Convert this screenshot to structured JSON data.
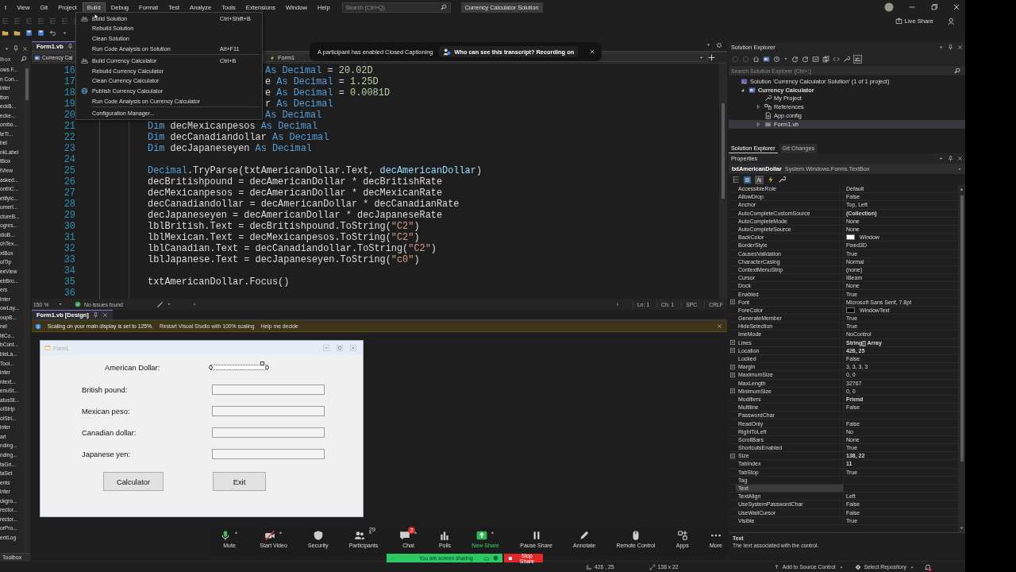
{
  "menu_bar": {
    "items": [
      {
        "label": "t",
        "selected": false
      },
      {
        "label": "View",
        "selected": false
      },
      {
        "label": "Git",
        "selected": false
      },
      {
        "label": "Project",
        "selected": false
      },
      {
        "label": "Build",
        "selected": true
      },
      {
        "label": "Debug",
        "selected": false
      },
      {
        "label": "Format",
        "selected": false
      },
      {
        "label": "Test",
        "selected": false
      },
      {
        "label": "Analyze",
        "selected": false
      },
      {
        "label": "Tools",
        "selected": false
      },
      {
        "label": "Extensions",
        "selected": false
      },
      {
        "label": "Window",
        "selected": false
      },
      {
        "label": "Help",
        "selected": false
      }
    ],
    "search": {
      "placeholder": "Search (Ctrl+Q)"
    },
    "solution_name": "Currency Calculator Solution"
  },
  "toolbar": {
    "live_share": "Live Share"
  },
  "build_menu": {
    "items": [
      {
        "kind": "build",
        "label": "Build Solution",
        "shortcut": "Ctrl+Shift+B"
      },
      {
        "kind": "plain",
        "label": "Rebuild Solution"
      },
      {
        "kind": "plain",
        "label": "Clean Solution"
      },
      {
        "kind": "plain",
        "label": "Run Code Analysis on Solution",
        "shortcut": "Alt+F11"
      },
      {
        "kind": "separator"
      },
      {
        "kind": "build",
        "label": "Build Currency Calculator",
        "shortcut": "Ctrl+B"
      },
      {
        "kind": "plain",
        "label": "Rebuild Currency Calculator"
      },
      {
        "kind": "plain",
        "label": "Clean Currency Calculator"
      },
      {
        "kind": "publish",
        "label": "Publish Currency Calculator"
      },
      {
        "kind": "plain",
        "label": "Run Code Analysis on Currency Calculator"
      },
      {
        "kind": "separator"
      },
      {
        "kind": "plain",
        "label": "Configuration Manager..."
      }
    ]
  },
  "toolbox": {
    "title": "lbox",
    "items": [
      "ows F...",
      "n Con...",
      "inter",
      "tton",
      "eckB...",
      "ecke...",
      "ombo...",
      "teTi...",
      "bel",
      "nkLabel",
      "tBox",
      "tView",
      "asked...",
      "onthC...",
      "etifyIc...",
      "umerI...",
      "ctureB...",
      "ogres...",
      "dioB...",
      "chTex...",
      "xtBox",
      "olTip",
      "eeView",
      "ebBro...",
      "ers",
      "inter",
      "owLay...",
      "oupB...",
      "nel",
      "litCo...",
      "bCont...",
      "bleLa...",
      "Tool...",
      "inter",
      "ntext...",
      "enuSt...",
      "atusSt...",
      "olStrip",
      "olStri...",
      "inter",
      "art",
      "nding...",
      "nding...",
      "taGri...",
      "taSet",
      "ents",
      "inter",
      "ckgro...",
      "rector...",
      "rector...",
      "orPro...",
      "entLog"
    ],
    "tab": "Toolbox"
  },
  "editor": {
    "tab": "Form1.vb",
    "nav": [
      "Currency Cal",
      "Form1"
    ],
    "lines_behind_menu": [
      {
        "number": "16",
        "tokens": [
          {
            "t": "As Decimal",
            "kind": "kw"
          },
          {
            "t": " = ",
            "kind": "plain"
          },
          {
            "t": "20.02D",
            "kind": "num"
          }
        ]
      },
      {
        "number": "17",
        "tokens": [
          {
            "t": "e ",
            "kind": "plain"
          },
          {
            "t": "As Decimal",
            "kind": "kw"
          },
          {
            "t": " = ",
            "kind": "plain"
          },
          {
            "t": "1.25D",
            "kind": "num"
          }
        ]
      },
      {
        "number": "18",
        "tokens": [
          {
            "t": "e ",
            "kind": "plain"
          },
          {
            "t": "As Decimal",
            "kind": "kw"
          },
          {
            "t": " = ",
            "kind": "plain"
          },
          {
            "t": "0.0081D",
            "kind": "num"
          }
        ]
      },
      {
        "number": "19",
        "tokens": [
          {
            "t": "r ",
            "kind": "plain"
          },
          {
            "t": "As Decimal",
            "kind": "kw"
          }
        ]
      },
      {
        "number": "20",
        "tokens": [
          {
            "t": "As Decimal",
            "kind": "kw"
          }
        ]
      }
    ],
    "lines": [
      {
        "number": "21",
        "tokens": [
          {
            "t": "Dim ",
            "kind": "kw"
          },
          {
            "t": "decMexicanpesos",
            "kind": "plain"
          },
          {
            "t": " As Decimal",
            "kind": "kw"
          }
        ]
      },
      {
        "number": "22",
        "tokens": [
          {
            "t": "Dim ",
            "kind": "kw"
          },
          {
            "t": "decCanadiandollar",
            "kind": "plain"
          },
          {
            "t": " As Decimal",
            "kind": "kw"
          }
        ]
      },
      {
        "number": "23",
        "tokens": [
          {
            "t": "Dim ",
            "kind": "kw"
          },
          {
            "t": "decJapaneseyen",
            "kind": "plain"
          },
          {
            "t": " As Decimal",
            "kind": "kw"
          }
        ]
      },
      {
        "number": "24"
      },
      {
        "number": "25",
        "tokens": [
          {
            "t": "Decimal",
            "kind": "kw"
          },
          {
            "t": ".TryParse(txtAmericanDollar.Text, ",
            "kind": "plain"
          },
          {
            "t": "decAmericanDollar",
            "kind": "param"
          },
          {
            "t": ")",
            "kind": "plain"
          }
        ]
      },
      {
        "number": "26",
        "tokens": [
          {
            "t": "decBritishpound = decAmericanDollar * decBritishRate",
            "kind": "plain"
          }
        ]
      },
      {
        "number": "27",
        "tokens": [
          {
            "t": "decMexicanpesos = decAmericanDollar * decMexicanRate",
            "kind": "plain"
          }
        ]
      },
      {
        "number": "28",
        "tokens": [
          {
            "t": "decCanadiandollar = decAmericanDollar * decCanadianRate",
            "kind": "plain"
          }
        ]
      },
      {
        "number": "29",
        "tokens": [
          {
            "t": "decJapaneseyen = decAmericanDollar * decJapaneseRate",
            "kind": "plain"
          }
        ]
      },
      {
        "number": "30",
        "tokens": [
          {
            "t": "lblBritish.Text = decBritishpound.ToString(",
            "kind": "plain"
          },
          {
            "t": "\"C2\"",
            "kind": "str"
          },
          {
            "t": ")",
            "kind": "plain"
          }
        ]
      },
      {
        "number": "31",
        "tokens": [
          {
            "t": "lblMexican.Text = decMexicanpesos.ToString(",
            "kind": "plain"
          },
          {
            "t": "\"C2\"",
            "kind": "str"
          },
          {
            "t": ")",
            "kind": "plain"
          }
        ]
      },
      {
        "number": "32",
        "tokens": [
          {
            "t": "lblCanadian.Text = decCanadiandollar.ToString(",
            "kind": "plain"
          },
          {
            "t": "\"C2\"",
            "kind": "str"
          },
          {
            "t": ")",
            "kind": "plain"
          }
        ]
      },
      {
        "number": "33",
        "tokens": [
          {
            "t": "lblJapanese.Text = decJapaneseyen.ToString(",
            "kind": "plain"
          },
          {
            "t": "\"c0\"",
            "kind": "str"
          },
          {
            "t": ")",
            "kind": "plain"
          }
        ]
      },
      {
        "number": "34"
      },
      {
        "number": "35",
        "tokens": [
          {
            "t": "txtAmericanDollar.Focus()",
            "kind": "plain"
          }
        ]
      },
      {
        "number": "36"
      }
    ],
    "status": {
      "zoom": "150 %",
      "issues": "No issues found",
      "line": "Ln: 1",
      "column": "Ch: 1",
      "spacing": "SPC",
      "line_ending": "CRLF"
    }
  },
  "caption_banner": {
    "message": "A participant has enabled Closed Captioning",
    "link": "Who can see this transcript? Recording on"
  },
  "designer": {
    "tab": "Form1.vb [Design]",
    "info_bar": {
      "message": "Scaling on your main display is set to 125%.",
      "actions": [
        "Restart Visual Studio with 100% scaling",
        "Help me decide"
      ]
    },
    "form": {
      "title": "Form1",
      "fields": [
        {
          "label": "American Dollar:",
          "selected": true
        },
        {
          "label": "British pound:",
          "selected": false
        },
        {
          "label": "Mexican peso:",
          "selected": false
        },
        {
          "label": "Canadian dollar:",
          "selected": false
        },
        {
          "label": "Japanese yen:",
          "selected": false
        }
      ],
      "buttons": [
        "Calculator",
        "Exit"
      ]
    }
  },
  "meeting_toolbar": {
    "items": [
      {
        "kind": "mic",
        "label": "Mute",
        "menu": true
      },
      {
        "kind": "camera",
        "label": "Start Video",
        "menu": true
      },
      {
        "kind": "shield",
        "label": "Security",
        "menu": false
      },
      {
        "kind": "people",
        "label": "Participants",
        "menu": true,
        "count": "29"
      },
      {
        "kind": "chat",
        "label": "Chat",
        "menu": true,
        "badge": "2"
      },
      {
        "kind": "polls",
        "label": "Polls",
        "menu": false
      },
      {
        "kind": "share",
        "label": "New Share",
        "menu": true
      },
      {
        "kind": "pause",
        "label": "Pause Share",
        "menu": false
      },
      {
        "kind": "pencil",
        "label": "Annotate",
        "menu": false
      },
      {
        "kind": "mouse",
        "label": "Remote Control",
        "menu": false
      },
      {
        "kind": "apps",
        "label": "Apps",
        "menu": false
      },
      {
        "kind": "more",
        "label": "More",
        "menu": false
      }
    ],
    "sharing": {
      "status": "You are screen sharing",
      "stop": "Stop Share"
    }
  },
  "solution_explorer": {
    "title": "Solution Explorer",
    "search": {
      "placeholder": "Search Solution Explorer (Ctrl+;)"
    },
    "tree": [
      {
        "kind": "solution",
        "label": "Solution 'Currency Calculator Solution' (1 of 1 project)",
        "selected": false,
        "children": [
          {
            "kind": "project",
            "label": "Currency Calculator",
            "expanded": true,
            "selected": false,
            "children": [
              {
                "kind": "wrench",
                "label": "My Project",
                "selected": false
              },
              {
                "kind": "references",
                "label": "References",
                "expanded": false,
                "selected": false
              },
              {
                "kind": "config",
                "label": "App.config",
                "selected": false
              },
              {
                "kind": "form",
                "label": "Form1.vb",
                "expanded": false,
                "selected": true
              }
            ]
          }
        ]
      }
    ],
    "tabs": [
      {
        "label": "Solution Explorer",
        "selected": true
      },
      {
        "label": "Git Changes",
        "selected": false
      }
    ]
  },
  "properties": {
    "title": "Properties",
    "object": "txtAmericanDollar",
    "type": "System.Windows.Forms.TextBox",
    "rows": [
      {
        "name": "AccessibleRole",
        "value": "Default",
        "modified": false,
        "selected": false
      },
      {
        "name": "AllowDrop",
        "value": "False",
        "modified": false,
        "selected": false
      },
      {
        "name": "Anchor",
        "value": "Top, Left",
        "modified": false,
        "selected": false
      },
      {
        "name": "AutoCompleteCustomSource",
        "value": "(Collection)",
        "modified": true,
        "selected": false
      },
      {
        "name": "AutoCompleteMode",
        "value": "None",
        "modified": false,
        "selected": false
      },
      {
        "name": "AutoCompleteSource",
        "value": "None",
        "modified": false,
        "selected": false
      },
      {
        "name": "BackColor",
        "value": "Window",
        "color": "#ffffff",
        "modified": false,
        "selected": false
      },
      {
        "name": "BorderStyle",
        "value": "Fixed3D",
        "modified": false,
        "selected": false
      },
      {
        "name": "CausesValidation",
        "value": "True",
        "modified": false,
        "selected": false
      },
      {
        "name": "CharacterCasing",
        "value": "Normal",
        "modified": false,
        "selected": false
      },
      {
        "name": "ContextMenuStrip",
        "value": "(none)",
        "modified": false,
        "selected": false
      },
      {
        "name": "Cursor",
        "value": "IBeam",
        "modified": false,
        "selected": false
      },
      {
        "name": "Dock",
        "value": "None",
        "modified": false,
        "selected": false
      },
      {
        "name": "Enabled",
        "value": "True",
        "modified": false,
        "selected": false
      },
      {
        "name": "Font",
        "value": "Microsoft Sans Serif, 7.8pt",
        "expanded": false,
        "modified": false,
        "selected": false
      },
      {
        "name": "ForeColor",
        "value": "WindowText",
        "color": "#000000",
        "modified": false,
        "selected": false
      },
      {
        "name": "GenerateMember",
        "value": "True",
        "modified": false,
        "selected": false
      },
      {
        "name": "HideSelection",
        "value": "True",
        "modified": false,
        "selected": false
      },
      {
        "name": "ImeMode",
        "value": "NoControl",
        "modified": false,
        "selected": false
      },
      {
        "name": "Lines",
        "value": "String[] Array",
        "expanded": false,
        "modified": true,
        "selected": false
      },
      {
        "name": "Location",
        "value": "426, 25",
        "expanded": false,
        "modified": true,
        "selected": false
      },
      {
        "name": "Locked",
        "value": "False",
        "modified": false,
        "selected": false
      },
      {
        "name": "Margin",
        "value": "3, 3, 3, 3",
        "expanded": false,
        "modified": false,
        "selected": false
      },
      {
        "name": "MaximumSize",
        "value": "0, 0",
        "expanded": false,
        "modified": false,
        "selected": false
      },
      {
        "name": "MaxLength",
        "value": "32767",
        "modified": false,
        "selected": false
      },
      {
        "name": "MinimumSize",
        "value": "0, 0",
        "expanded": false,
        "modified": false,
        "selected": false
      },
      {
        "name": "Modifiers",
        "value": "Friend",
        "modified": true,
        "selected": false
      },
      {
        "name": "Multiline",
        "value": "False",
        "modified": false,
        "selected": false
      },
      {
        "name": "PasswordChar",
        "selected": false
      },
      {
        "name": "ReadOnly",
        "value": "False",
        "modified": false,
        "selected": false
      },
      {
        "name": "RightToLeft",
        "value": "No",
        "modified": false,
        "selected": false
      },
      {
        "name": "ScrollBars",
        "value": "None",
        "modified": false,
        "selected": false
      },
      {
        "name": "ShortcutsEnabled",
        "value": "True",
        "modified": false,
        "selected": false
      },
      {
        "name": "Size",
        "value": "138, 22",
        "expanded": false,
        "modified": true,
        "selected": false
      },
      {
        "name": "TabIndex",
        "value": "11",
        "modified": true,
        "selected": false
      },
      {
        "name": "TabStop",
        "value": "True",
        "modified": false,
        "selected": false
      },
      {
        "name": "Tag",
        "selected": false
      },
      {
        "name": "Text",
        "selected": true
      },
      {
        "name": "TextAlign",
        "value": "Left",
        "modified": false,
        "selected": false
      },
      {
        "name": "UseSystemPasswordChar",
        "value": "False",
        "modified": false,
        "selected": false
      },
      {
        "name": "UseWaitCursor",
        "value": "False",
        "modified": false,
        "selected": false
      },
      {
        "name": "Visible",
        "value": "True",
        "modified": false,
        "selected": false
      }
    ],
    "description": {
      "title": "Text",
      "text": "The text associated with the control."
    }
  },
  "status_bar": {
    "position": "426 , 25",
    "size": "138 x 22",
    "source_control": "Add to Source Control",
    "repository": "Select Repository"
  }
}
